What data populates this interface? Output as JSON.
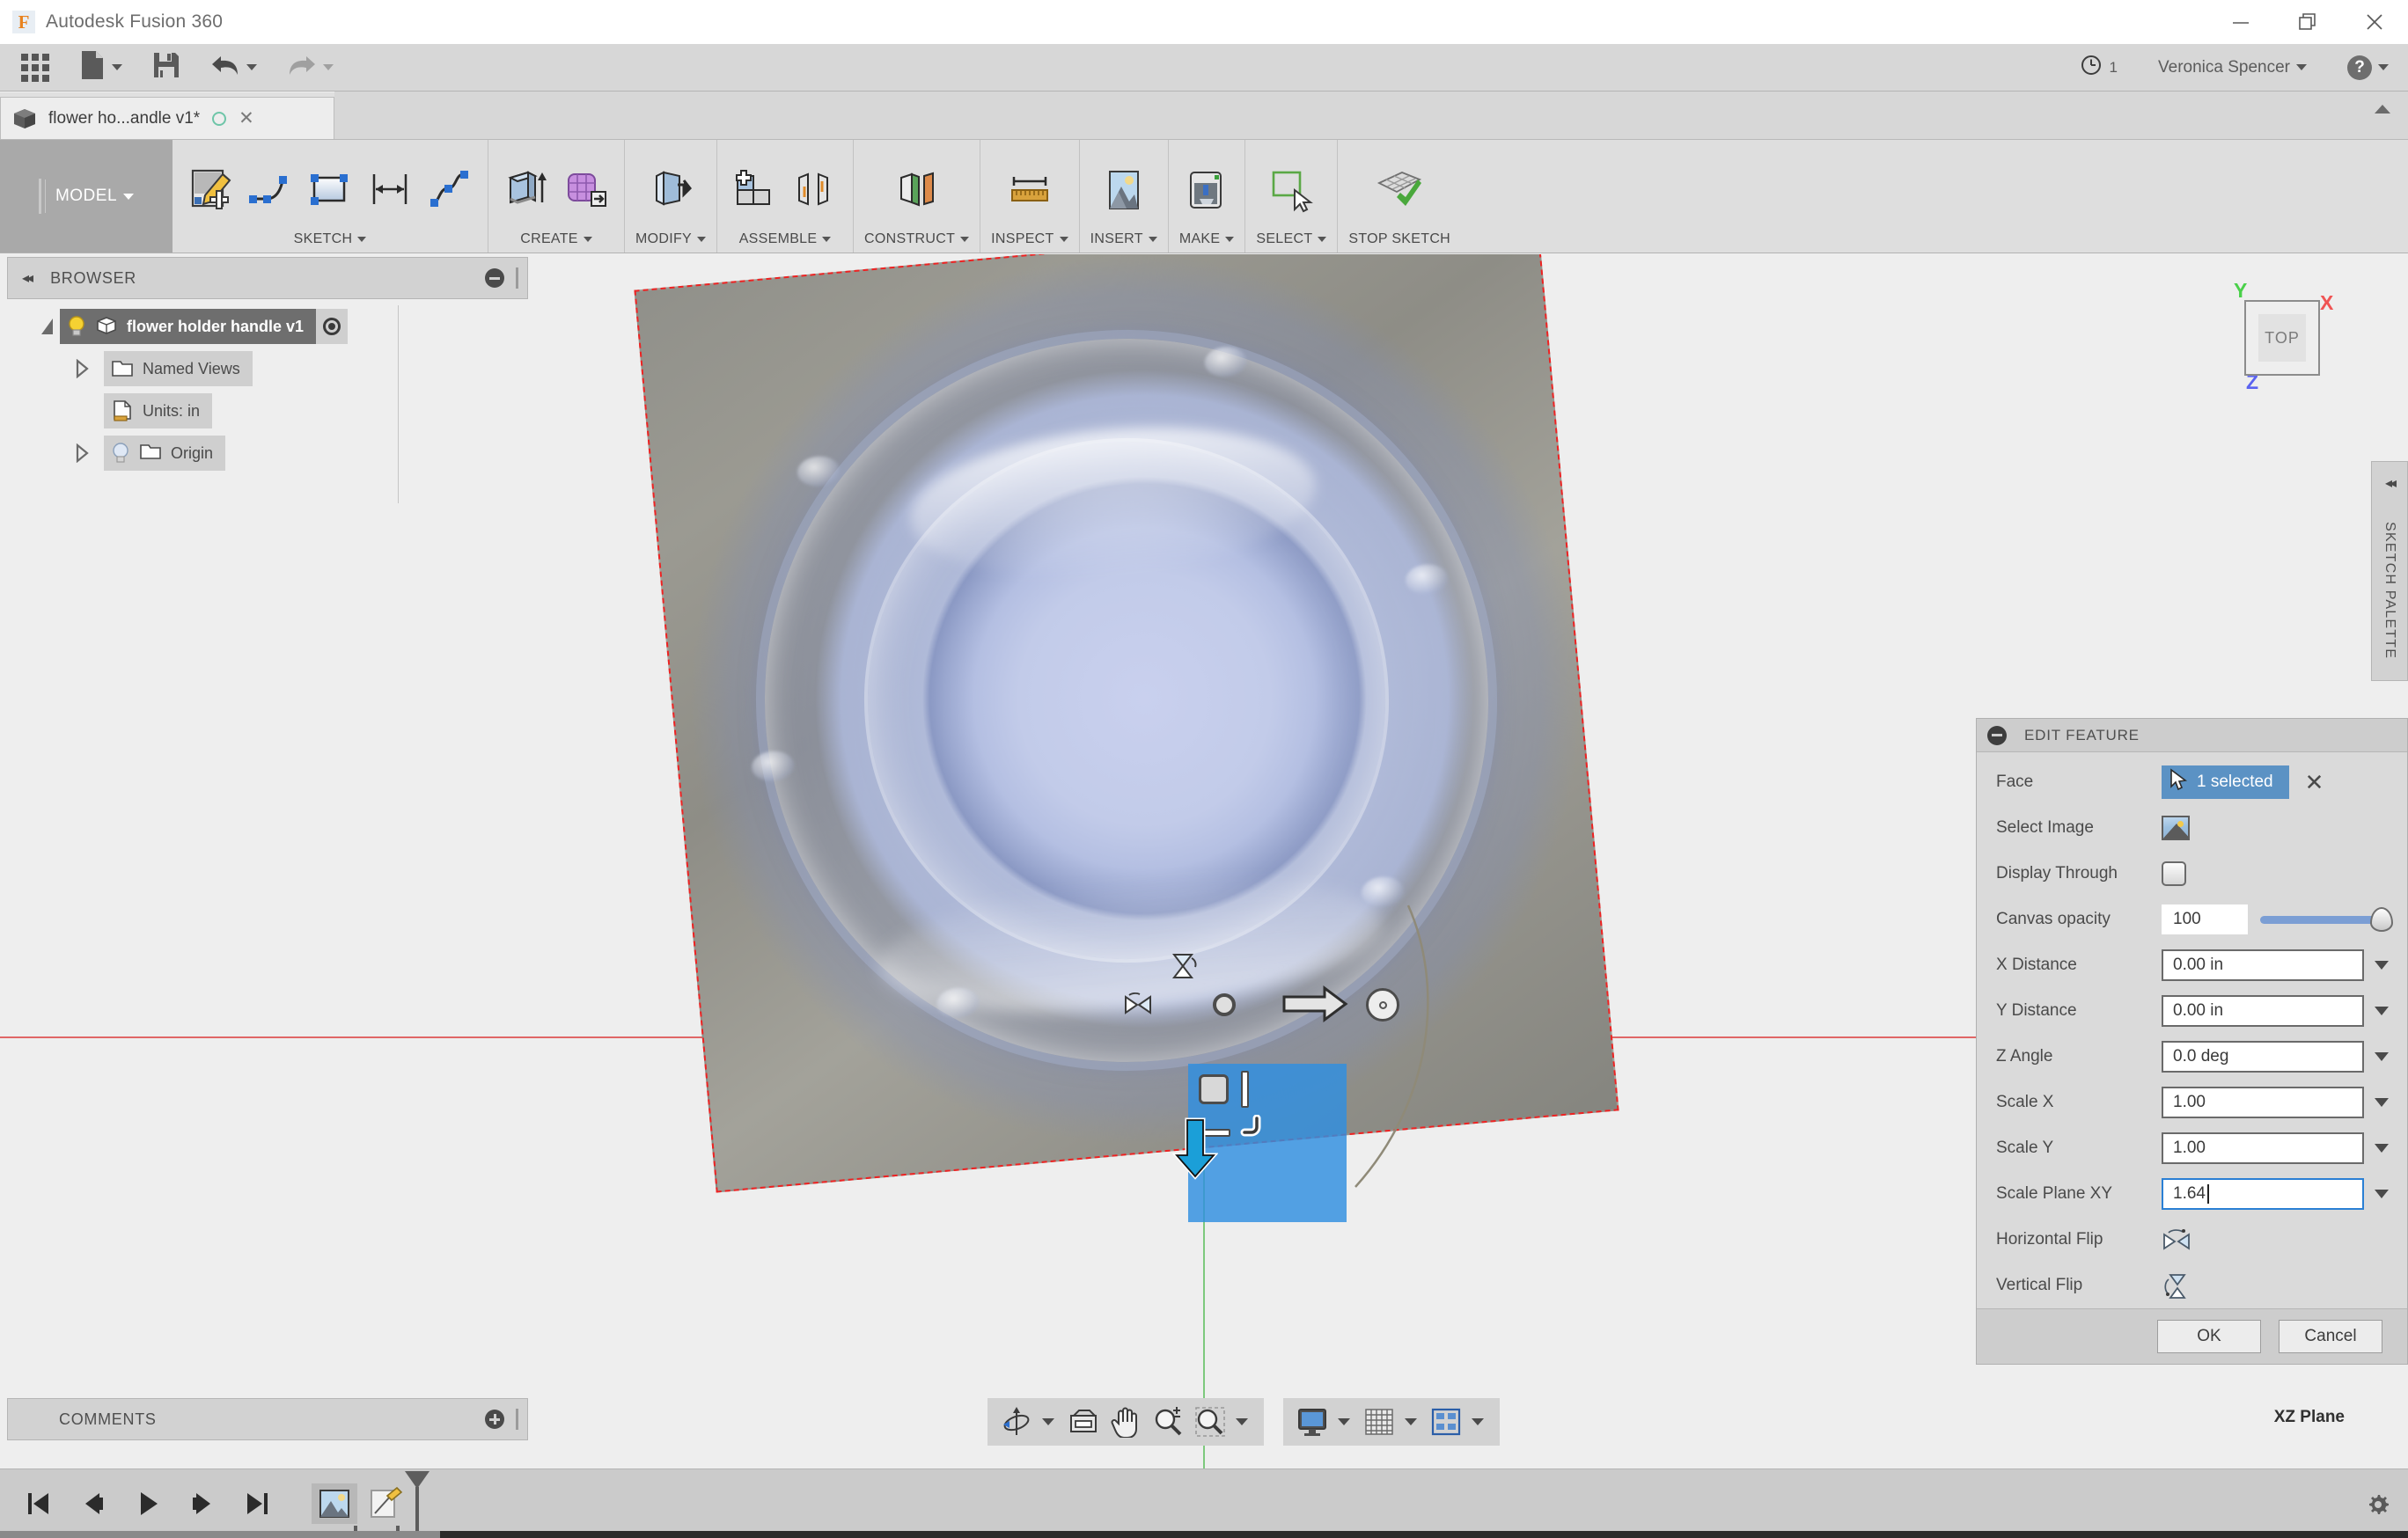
{
  "window": {
    "app_title": "Autodesk Fusion 360",
    "logo_letter": "F",
    "minimize_label": "Minimize",
    "restore_label": "Restore",
    "close_label": "Close"
  },
  "quick_access": {
    "grid_label": "show-data-panel",
    "new_label": "New",
    "save_label": "Save",
    "undo_label": "Undo",
    "redo_label": "Redo",
    "jobs_count": "1",
    "user_name": "Veronica Spencer",
    "help_label": "?"
  },
  "tabs": {
    "document_label": "flower ho...andle v1*",
    "close_label": "✕"
  },
  "ribbon": {
    "workspace_label": "MODEL",
    "groups": [
      {
        "label": "SKETCH",
        "dropdown": true,
        "buttons": [
          "create-sketch-icon",
          "line-arc-icon",
          "rectangle-icon",
          "dimension-icon",
          "spline-icon"
        ]
      },
      {
        "label": "CREATE",
        "dropdown": true,
        "buttons": [
          "extrude-icon",
          "form-icon"
        ]
      },
      {
        "label": "MODIFY",
        "dropdown": true,
        "buttons": [
          "press-pull-icon"
        ]
      },
      {
        "label": "ASSEMBLE",
        "dropdown": true,
        "buttons": [
          "new-component-icon",
          "joint-icon"
        ]
      },
      {
        "label": "CONSTRUCT",
        "dropdown": true,
        "buttons": [
          "offset-plane-icon"
        ]
      },
      {
        "label": "INSPECT",
        "dropdown": true,
        "buttons": [
          "measure-icon"
        ]
      },
      {
        "label": "INSERT",
        "dropdown": true,
        "buttons": [
          "insert-canvas-icon"
        ]
      },
      {
        "label": "MAKE",
        "dropdown": true,
        "buttons": [
          "3d-print-icon"
        ]
      },
      {
        "label": "SELECT",
        "dropdown": true,
        "buttons": [
          "select-icon"
        ]
      },
      {
        "label": "STOP SKETCH",
        "dropdown": false,
        "buttons": [
          "stop-sketch-icon"
        ]
      }
    ]
  },
  "browser": {
    "title": "BROWSER",
    "collapse_label": "◂◂",
    "items": [
      {
        "label": "flower holder handle v1",
        "selected": true,
        "expander": "open",
        "icon": "component-icon",
        "bulb": "on",
        "visibility_toggle": true
      },
      {
        "label": "Named Views",
        "selected": false,
        "expander": "closed",
        "icon": "folder-icon",
        "bulb": "none",
        "visibility_toggle": false
      },
      {
        "label": "Units: in",
        "selected": false,
        "expander": "none",
        "icon": "units-doc-icon",
        "bulb": "none",
        "visibility_toggle": false
      },
      {
        "label": "Origin",
        "selected": false,
        "expander": "closed",
        "icon": "folder-icon",
        "bulb": "dim",
        "visibility_toggle": false
      }
    ]
  },
  "comments": {
    "title": "COMMENTS"
  },
  "sketch_palette": {
    "title": "SKETCH PALETTE",
    "collapse_label": "◂◂"
  },
  "viewcube": {
    "face_label": "TOP",
    "axis_x": "X",
    "axis_y": "Y",
    "axis_z": "Z",
    "color_x": "#f05454",
    "color_y": "#49d049",
    "color_z": "#5b63f0"
  },
  "canvas": {
    "axis_h_color": "#e06666",
    "axis_v_color": "#7dc97d",
    "canvas_border_color": "#ee2222",
    "manipulator_fill": "#2f8fe0",
    "image_description": "photo of a clear glass dish viewed from above on a woven mat"
  },
  "edit_feature": {
    "title": "EDIT FEATURE",
    "rows": [
      {
        "label": "Face",
        "type": "selection",
        "value": "1 selected"
      },
      {
        "label": "Select Image",
        "type": "image-button",
        "value": ""
      },
      {
        "label": "Display Through",
        "type": "checkbox",
        "value": ""
      },
      {
        "label": "Canvas opacity",
        "type": "slider",
        "value": "100",
        "percent": 100
      },
      {
        "label": "X Distance",
        "type": "field",
        "value": "0.00 in"
      },
      {
        "label": "Y Distance",
        "type": "field",
        "value": "0.00 in"
      },
      {
        "label": "Z Angle",
        "type": "field",
        "value": "0.0 deg"
      },
      {
        "label": "Scale X",
        "type": "field",
        "value": "1.00"
      },
      {
        "label": "Scale Y",
        "type": "field",
        "value": "1.00"
      },
      {
        "label": "Scale Plane XY",
        "type": "field",
        "value": "1.64",
        "focused": true
      },
      {
        "label": "Horizontal Flip",
        "type": "flip",
        "value": ""
      },
      {
        "label": "Vertical Flip",
        "type": "flip",
        "value": ""
      }
    ],
    "ok_label": "OK",
    "cancel_label": "Cancel",
    "selection_color": "#5b92c4",
    "focus_color": "#2a7fd4"
  },
  "plane_label": "XZ Plane",
  "view_toolbar": {
    "orbit_label": "orbit-icon",
    "look_at_label": "look-at-icon",
    "pan_label": "pan-icon",
    "zoom_label": "zoom-icon",
    "fit_label": "fit-icon",
    "display_settings_label": "display-settings-icon",
    "grid_snaps_label": "grid-snaps-icon",
    "viewports_label": "viewports-icon"
  },
  "timeline": {
    "first_label": "go-to-start",
    "prev_label": "step-back",
    "play_label": "play",
    "next_label": "step-forward",
    "last_label": "go-to-end",
    "features": [
      "canvas-feature-icon",
      "sketch-feature-icon"
    ],
    "settings_label": "settings-gear"
  }
}
